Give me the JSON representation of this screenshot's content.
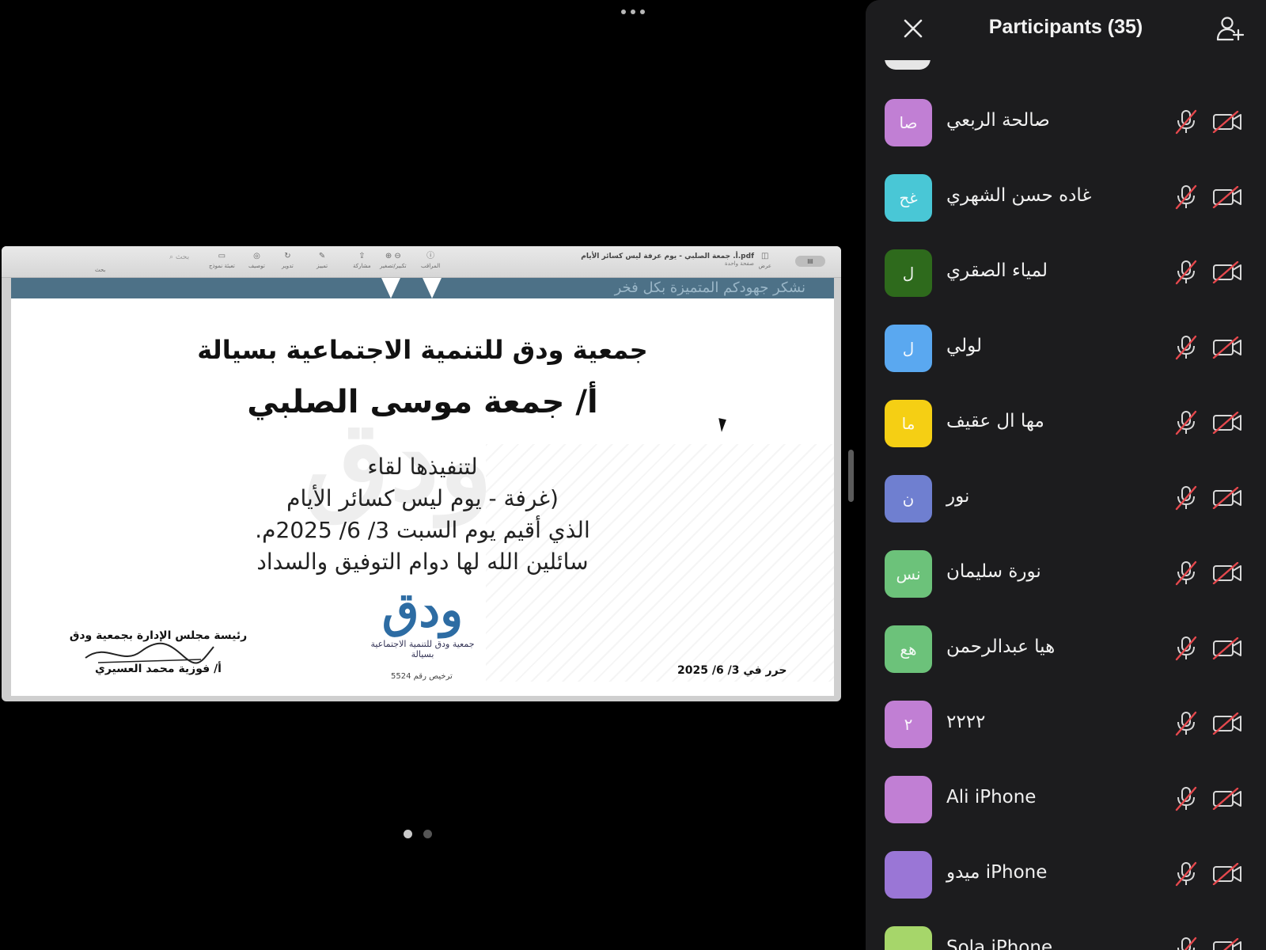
{
  "document": {
    "filename": "أ. جمعة الصلبي - يوم عرفة ليس كسائر الأيام.pdf",
    "page_mode": "صفحة واحدة",
    "toolbar": {
      "view_label": "عرض",
      "inspector_label": "المراقب",
      "zoom_label": "تكبير/تصغير",
      "share_label": "مشاركة",
      "markup_label": "تمييز",
      "rotate_label": "تدوير",
      "annotate_label": "توصيف",
      "form_label": "تعبئة نموذج",
      "search_placeholder": "بحث",
      "search_label": "بحث"
    },
    "banner_text": "نشكر جهودكم المتميزة بكل فخر",
    "watermark": "ودق",
    "organization": "جمعية ودق للتنمية الاجتماعية بسيالة",
    "recipient": "أ/ جمعة موسى الصلبي",
    "body_lines": [
      "لتنفيذها لقاء",
      "(غرفة - يوم ليس كسائر الأيام",
      "الذي أقيم يوم السبت 3/ 6/ 2025م.",
      "سائلين الله لها دوام التوفيق والسداد"
    ],
    "logo_caption": "جمعية ودق للتنمية الاجتماعية بسيالة",
    "logo_mark": "ودق",
    "license": "ترخيص رقم 5524",
    "signatory_title": "رئيسة مجلس الإدارة بجمعية ودق",
    "signatory_name": "أ/ فوزية محمد العسيري",
    "issued": "حرر في 3/ 6/ 2025"
  },
  "panel": {
    "title": "Participants (35)",
    "participants": [
      {
        "name": "صالحة الربعي",
        "initials": "صا",
        "color": "#c17fd4",
        "mic": "muted",
        "camera": "off"
      },
      {
        "name": "غاده حسن الشهري",
        "initials": "غح",
        "color": "#49c7d6",
        "mic": "muted",
        "camera": "off"
      },
      {
        "name": "لمياء الصقري",
        "initials": "ل",
        "color": "#2e6a1c",
        "mic": "muted",
        "camera": "off"
      },
      {
        "name": "لولي",
        "initials": "ل",
        "color": "#5aa8f0",
        "mic": "muted",
        "camera": "off"
      },
      {
        "name": "مها ال عقيف",
        "initials": "ما",
        "color": "#f5cf14",
        "mic": "muted",
        "camera": "off"
      },
      {
        "name": "نور",
        "initials": "ن",
        "color": "#6f7fd0",
        "mic": "muted",
        "camera": "off"
      },
      {
        "name": "نورة سليمان",
        "initials": "نس",
        "color": "#6cc27a",
        "mic": "muted",
        "camera": "off"
      },
      {
        "name": "هيا عبدالرحمن",
        "initials": "هع",
        "color": "#6cc27a",
        "mic": "muted",
        "camera": "off"
      },
      {
        "name": "٢٢٢٢",
        "initials": "٢",
        "color": "#c17fd4",
        "mic": "muted",
        "camera": "off"
      },
      {
        "name": "Ali iPhone",
        "initials": "",
        "color": "#c17fd4",
        "mic": "muted",
        "camera": "off"
      },
      {
        "name": "ميدو iPhone",
        "initials": "",
        "color": "#9a76d6",
        "mic": "muted",
        "camera": "off"
      },
      {
        "name": "Sola iPhone",
        "initials": "",
        "color": "#a6d66a",
        "mic": "muted",
        "camera": "off"
      }
    ]
  },
  "icons": {
    "close": "close-icon",
    "invite": "add-person-icon",
    "mic_muted": "mic-muted-icon",
    "camera_off": "camera-off-icon",
    "more": "more-dots-icon"
  },
  "colors": {
    "background": "#000000",
    "panel": "#1c1c1e",
    "muted_slash": "#e5484d",
    "banner": "#4d7187"
  }
}
